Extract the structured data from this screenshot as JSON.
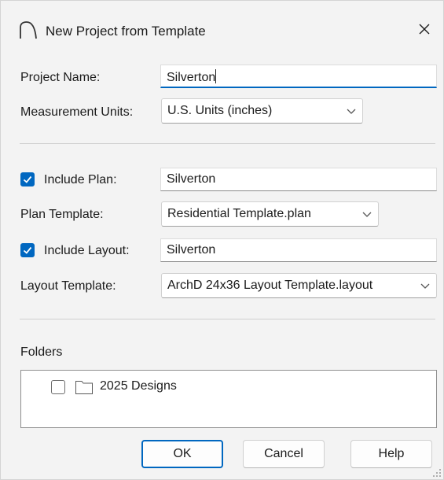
{
  "window": {
    "title": "New Project from Template",
    "close_icon": "close-icon",
    "app_icon": "arch-app-icon"
  },
  "project": {
    "name_label": "Project Name:",
    "name_value": "Silverton",
    "units_label": "Measurement Units:",
    "units_value": "U.S. Units (inches)"
  },
  "plan": {
    "include_label": "Include Plan:",
    "include_checked": true,
    "name_value": "Silverton",
    "template_label": "Plan Template:",
    "template_value": "Residential Template.plan"
  },
  "layout": {
    "include_label": "Include Layout:",
    "include_checked": true,
    "name_value": "Silverton",
    "template_label": "Layout Template:",
    "template_value": "ArchD 24x36 Layout Template.layout"
  },
  "folders": {
    "label": "Folders",
    "items": [
      {
        "name": "2025 Designs",
        "checked": false,
        "icon": "folder-icon"
      }
    ]
  },
  "buttons": {
    "ok": "OK",
    "cancel": "Cancel",
    "help": "Help"
  },
  "colors": {
    "accent": "#0067c0",
    "dialog_bg": "#f3f3f3"
  }
}
